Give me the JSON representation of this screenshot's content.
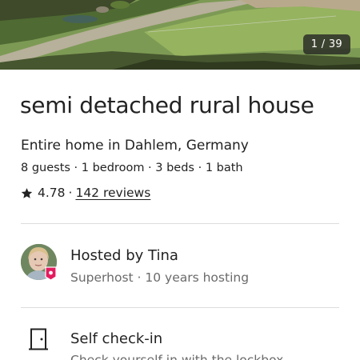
{
  "gallery": {
    "counter": "1 / 39"
  },
  "listing": {
    "title": "semi detached rural house",
    "subtitle": "Entire home in Dahlem, Germany",
    "details": "8 guests · 1 bedroom · 3 beds · 1 bath",
    "rating": "4.78",
    "separator": "·",
    "reviews_link": "142 reviews"
  },
  "host": {
    "name": "Hosted by Tina",
    "meta": "Superhost · 10 years hosting"
  },
  "features": [
    {
      "icon": "door-icon",
      "title": "Self check-in",
      "description": "Check yourself in with the lockbox."
    }
  ],
  "colors": {
    "text": "#222222",
    "secondary_text": "#6a6a6a",
    "divider": "#dddddd",
    "superhost_badge": "#e31c5f"
  }
}
